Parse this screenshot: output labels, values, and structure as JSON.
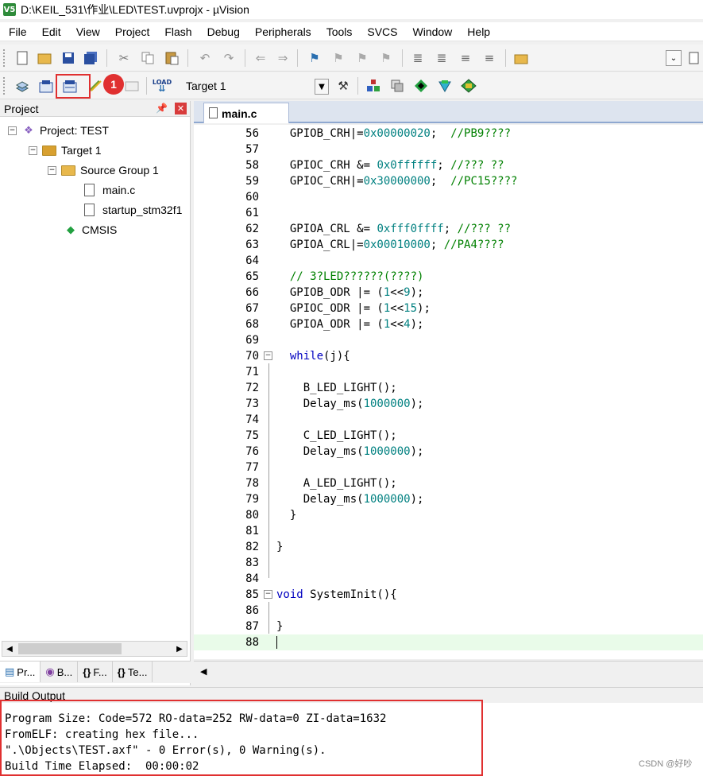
{
  "window": {
    "title": "D:\\KEIL_531\\作业\\LED\\TEST.uvprojx - µVision",
    "app_icon_text": "V5"
  },
  "menu": [
    "File",
    "Edit",
    "View",
    "Project",
    "Flash",
    "Debug",
    "Peripherals",
    "Tools",
    "SVCS",
    "Window",
    "Help"
  ],
  "toolbar2": {
    "target_name": "Target 1",
    "badge_number": "1",
    "load_icon_label": "LOAD"
  },
  "project_panel": {
    "title": "Project",
    "tree": {
      "project": "Project: TEST",
      "target": "Target 1",
      "group": "Source Group 1",
      "files": [
        "main.c",
        "startup_stm32f1"
      ],
      "cmsis": "CMSIS"
    },
    "tabs": [
      "Pr...",
      "B...",
      "F...",
      "Te..."
    ]
  },
  "editor": {
    "tab_title": "main.c",
    "lines": [
      {
        "n": "56",
        "code": "  GPIOB_CRH|=0x00000020;  //PB9????"
      },
      {
        "n": "57",
        "code": ""
      },
      {
        "n": "58",
        "code": "  GPIOC_CRH &= 0x0ffffff; //??? ??"
      },
      {
        "n": "59",
        "code": "  GPIOC_CRH|=0x30000000;  //PC15????"
      },
      {
        "n": "60",
        "code": ""
      },
      {
        "n": "61",
        "code": ""
      },
      {
        "n": "62",
        "code": "  GPIOA_CRL &= 0xfff0ffff; //??? ??"
      },
      {
        "n": "63",
        "code": "  GPIOA_CRL|=0x00010000; //PA4????"
      },
      {
        "n": "64",
        "code": ""
      },
      {
        "n": "65",
        "code": "  // 3?LED??????(????)"
      },
      {
        "n": "66",
        "code": "  GPIOB_ODR |= (1<<9);"
      },
      {
        "n": "67",
        "code": "  GPIOC_ODR |= (1<<15);"
      },
      {
        "n": "68",
        "code": "  GPIOA_ODR |= (1<<4);"
      },
      {
        "n": "69",
        "code": ""
      },
      {
        "n": "70",
        "code": "  while(j){"
      },
      {
        "n": "71",
        "code": ""
      },
      {
        "n": "72",
        "code": "    B_LED_LIGHT();"
      },
      {
        "n": "73",
        "code": "    Delay_ms(1000000);"
      },
      {
        "n": "74",
        "code": ""
      },
      {
        "n": "75",
        "code": "    C_LED_LIGHT();"
      },
      {
        "n": "76",
        "code": "    Delay_ms(1000000);"
      },
      {
        "n": "77",
        "code": ""
      },
      {
        "n": "78",
        "code": "    A_LED_LIGHT();"
      },
      {
        "n": "79",
        "code": "    Delay_ms(1000000);"
      },
      {
        "n": "80",
        "code": "  }"
      },
      {
        "n": "81",
        "code": ""
      },
      {
        "n": "82",
        "code": "}"
      },
      {
        "n": "83",
        "code": ""
      },
      {
        "n": "84",
        "code": ""
      },
      {
        "n": "85",
        "code": "void SystemInit(){"
      },
      {
        "n": "86",
        "code": ""
      },
      {
        "n": "87",
        "code": "}"
      },
      {
        "n": "88",
        "code": ""
      }
    ]
  },
  "build_output": {
    "title": "Build Output",
    "lines": [
      "Program Size: Code=572 RO-data=252 RW-data=0 ZI-data=1632",
      "FromELF: creating hex file...",
      "\".\\Objects\\TEST.axf\" - 0 Error(s), 0 Warning(s).",
      "Build Time Elapsed:  00:00:02"
    ]
  },
  "watermark": "CSDN @好吵"
}
